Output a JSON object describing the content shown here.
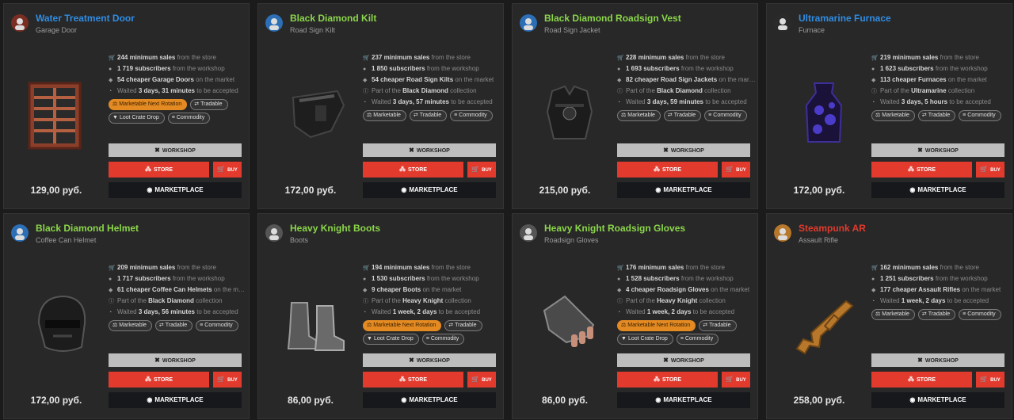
{
  "colors": {
    "accent_blue": "#2f8de4",
    "accent_green": "#8bd64a",
    "accent_red": "#e23a2d",
    "tag_orange": "#e38a23"
  },
  "buttons": {
    "workshop": "WORKSHOP",
    "store": "STORE",
    "buy": "BUY",
    "marketplace": "MARKETPLACE"
  },
  "icons": {
    "sales": "cart-icon",
    "subscribers": "person-icon",
    "cheaper": "tag-icon",
    "collection": "info-icon",
    "waited": "clock-icon",
    "workshop": "tools-icon",
    "store": "share-icon",
    "buy": "cart-icon",
    "marketplace": "steam-icon"
  },
  "items": [
    {
      "name": "Water Treatment Door",
      "name_color": "#2f8de4",
      "subtitle": "Garage Door",
      "price": "129,00 руб.",
      "art": "door",
      "stats": [
        {
          "icon": "cart-icon",
          "strong": "244 minimum sales",
          "rest": " from the store"
        },
        {
          "icon": "person-icon",
          "strong": "1 719 subscribers",
          "rest": " from the workshop"
        },
        {
          "icon": "tag-icon",
          "strong": "54 cheaper Garage Doors",
          "rest": " on the market"
        },
        {
          "icon": "clock-icon",
          "pre": "Waited ",
          "strong": "3 days, 31 minutes",
          "rest": " to be accepted"
        }
      ],
      "tags": [
        {
          "label": "Marketable Next Rotation",
          "orange": true,
          "icon": "scale-icon"
        },
        {
          "label": "Tradable",
          "icon": "swap-icon"
        },
        {
          "label": "Loot Crate Drop",
          "icon": "crate-icon"
        },
        {
          "label": "Commodity",
          "icon": "stack-icon"
        }
      ]
    },
    {
      "name": "Black Diamond Kilt",
      "name_color": "#8bd64a",
      "subtitle": "Road Sign Kilt",
      "price": "172,00 руб.",
      "art": "kilt",
      "stats": [
        {
          "icon": "cart-icon",
          "strong": "237 minimum sales",
          "rest": " from the store"
        },
        {
          "icon": "person-icon",
          "strong": "1 850 subscribers",
          "rest": " from the workshop"
        },
        {
          "icon": "tag-icon",
          "strong": "54 cheaper Road Sign Kilts",
          "rest": " on the market"
        },
        {
          "icon": "info-icon",
          "pre": "Part of the ",
          "strong": "Black Diamond",
          "rest": " collection"
        },
        {
          "icon": "clock-icon",
          "pre": "Waited ",
          "strong": "3 days, 57 minutes",
          "rest": " to be accepted"
        }
      ],
      "tags": [
        {
          "label": "Marketable",
          "icon": "scale-icon"
        },
        {
          "label": "Tradable",
          "icon": "swap-icon"
        },
        {
          "label": "Commodity",
          "icon": "stack-icon"
        }
      ]
    },
    {
      "name": "Black Diamond Roadsign Vest",
      "name_color": "#8bd64a",
      "subtitle": "Road Sign Jacket",
      "price": "215,00 руб.",
      "art": "vest",
      "stats": [
        {
          "icon": "cart-icon",
          "strong": "228 minimum sales",
          "rest": " from the store"
        },
        {
          "icon": "person-icon",
          "strong": "1 693 subscribers",
          "rest": " from the workshop"
        },
        {
          "icon": "tag-icon",
          "strong": "82 cheaper Road Sign Jackets",
          "rest": " on the mar…"
        },
        {
          "icon": "info-icon",
          "pre": "Part of the ",
          "strong": "Black Diamond",
          "rest": " collection"
        },
        {
          "icon": "clock-icon",
          "pre": "Waited ",
          "strong": "3 days, 59 minutes",
          "rest": " to be accepted"
        }
      ],
      "tags": [
        {
          "label": "Marketable",
          "icon": "scale-icon"
        },
        {
          "label": "Tradable",
          "icon": "swap-icon"
        },
        {
          "label": "Commodity",
          "icon": "stack-icon"
        }
      ]
    },
    {
      "name": "Ultramarine Furnace",
      "name_color": "#2f8de4",
      "subtitle": "Furnace",
      "price": "172,00 руб.",
      "art": "furnace",
      "stats": [
        {
          "icon": "cart-icon",
          "strong": "219 minimum sales",
          "rest": " from the store"
        },
        {
          "icon": "person-icon",
          "strong": "1 623 subscribers",
          "rest": " from the workshop"
        },
        {
          "icon": "tag-icon",
          "strong": "113 cheaper Furnaces",
          "rest": " on the market"
        },
        {
          "icon": "info-icon",
          "pre": "Part of the ",
          "strong": "Ultramarine",
          "rest": " collection"
        },
        {
          "icon": "clock-icon",
          "pre": "Waited ",
          "strong": "3 days, 5 hours",
          "rest": " to be accepted"
        }
      ],
      "tags": [
        {
          "label": "Marketable",
          "icon": "scale-icon"
        },
        {
          "label": "Tradable",
          "icon": "swap-icon"
        },
        {
          "label": "Commodity",
          "icon": "stack-icon"
        }
      ]
    },
    {
      "name": "Black Diamond Helmet",
      "name_color": "#8bd64a",
      "subtitle": "Coffee Can Helmet",
      "price": "172,00 руб.",
      "art": "helmet",
      "stats": [
        {
          "icon": "cart-icon",
          "strong": "209 minimum sales",
          "rest": " from the store"
        },
        {
          "icon": "person-icon",
          "strong": "1 717 subscribers",
          "rest": " from the workshop"
        },
        {
          "icon": "tag-icon",
          "strong": "61 cheaper Coffee Can Helmets",
          "rest": " on the m…"
        },
        {
          "icon": "info-icon",
          "pre": "Part of the ",
          "strong": "Black Diamond",
          "rest": " collection"
        },
        {
          "icon": "clock-icon",
          "pre": "Waited ",
          "strong": "3 days, 56 minutes",
          "rest": " to be accepted"
        }
      ],
      "tags": [
        {
          "label": "Marketable",
          "icon": "scale-icon"
        },
        {
          "label": "Tradable",
          "icon": "swap-icon"
        },
        {
          "label": "Commodity",
          "icon": "stack-icon"
        }
      ]
    },
    {
      "name": "Heavy Knight Boots",
      "name_color": "#8bd64a",
      "subtitle": "Boots",
      "price": "86,00 руб.",
      "art": "boots",
      "stats": [
        {
          "icon": "cart-icon",
          "strong": "194 minimum sales",
          "rest": " from the store"
        },
        {
          "icon": "person-icon",
          "strong": "1 530 subscribers",
          "rest": " from the workshop"
        },
        {
          "icon": "tag-icon",
          "strong": "9 cheaper Boots",
          "rest": " on the market"
        },
        {
          "icon": "info-icon",
          "pre": "Part of the ",
          "strong": "Heavy Knight",
          "rest": " collection"
        },
        {
          "icon": "clock-icon",
          "pre": "Waited ",
          "strong": "1 week, 2 days",
          "rest": " to be accepted"
        }
      ],
      "tags": [
        {
          "label": "Marketable Next Rotation",
          "orange": true,
          "icon": "scale-icon"
        },
        {
          "label": "Tradable",
          "icon": "swap-icon"
        },
        {
          "label": "Loot Crate Drop",
          "icon": "crate-icon"
        },
        {
          "label": "Commodity",
          "icon": "stack-icon"
        }
      ]
    },
    {
      "name": "Heavy Knight Roadsign Gloves",
      "name_color": "#8bd64a",
      "subtitle": "Roadsign Gloves",
      "price": "86,00 руб.",
      "art": "gloves",
      "stats": [
        {
          "icon": "cart-icon",
          "strong": "176 minimum sales",
          "rest": " from the store"
        },
        {
          "icon": "person-icon",
          "strong": "1 528 subscribers",
          "rest": " from the workshop"
        },
        {
          "icon": "tag-icon",
          "strong": "4 cheaper Roadsign Gloves",
          "rest": " on the market"
        },
        {
          "icon": "info-icon",
          "pre": "Part of the ",
          "strong": "Heavy Knight",
          "rest": " collection"
        },
        {
          "icon": "clock-icon",
          "pre": "Waited ",
          "strong": "1 week, 2 days",
          "rest": " to be accepted"
        }
      ],
      "tags": [
        {
          "label": "Marketable Next Rotation",
          "orange": true,
          "icon": "scale-icon"
        },
        {
          "label": "Tradable",
          "icon": "swap-icon"
        },
        {
          "label": "Loot Crate Drop",
          "icon": "crate-icon"
        },
        {
          "label": "Commodity",
          "icon": "stack-icon"
        }
      ]
    },
    {
      "name": "Steampunk AR",
      "name_color": "#e23a2d",
      "subtitle": "Assault Rifle",
      "price": "258,00 руб.",
      "art": "rifle",
      "stats": [
        {
          "icon": "cart-icon",
          "strong": "162 minimum sales",
          "rest": " from the store"
        },
        {
          "icon": "person-icon",
          "strong": "1 251 subscribers",
          "rest": " from the workshop"
        },
        {
          "icon": "tag-icon",
          "strong": "177 cheaper Assault Rifles",
          "rest": " on the market"
        },
        {
          "icon": "clock-icon",
          "pre": "Waited ",
          "strong": "1 week, 2 days",
          "rest": " to be accepted"
        }
      ],
      "tags": [
        {
          "label": "Marketable",
          "icon": "scale-icon"
        },
        {
          "label": "Tradable",
          "icon": "swap-icon"
        },
        {
          "label": "Commodity",
          "icon": "stack-icon"
        }
      ]
    }
  ]
}
